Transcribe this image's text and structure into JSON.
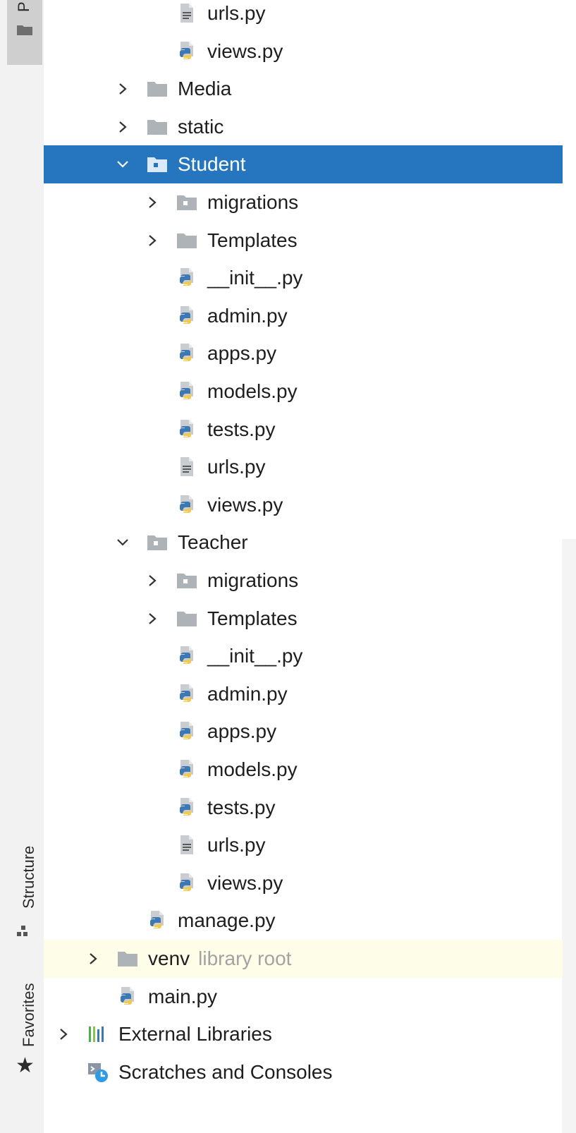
{
  "tool_windows": {
    "project_tab_letter": "P",
    "structure_label": "Structure",
    "favorites_label": "Favorites"
  },
  "colors": {
    "selection": "#2675bf",
    "excluded_background": "#fdfde8",
    "python_blue": "#3b78b4",
    "python_yellow": "#f2c94c"
  },
  "tree": [
    {
      "label": "urls.py",
      "icon": "text-file-icon",
      "level": 4,
      "chevron": "none"
    },
    {
      "label": "views.py",
      "icon": "python-file-icon",
      "level": 4,
      "chevron": "none"
    },
    {
      "label": "Media",
      "icon": "folder-icon",
      "level": 3,
      "chevron": "collapsed"
    },
    {
      "label": "static",
      "icon": "folder-icon",
      "level": 3,
      "chevron": "collapsed"
    },
    {
      "label": "Student",
      "icon": "package-folder-icon",
      "level": 3,
      "chevron": "expanded",
      "selected": true
    },
    {
      "label": "migrations",
      "icon": "package-folder-icon",
      "level": 4,
      "chevron": "collapsed"
    },
    {
      "label": "Templates",
      "icon": "folder-icon",
      "level": 4,
      "chevron": "collapsed"
    },
    {
      "label": "__init__.py",
      "icon": "python-file-icon",
      "level": 4,
      "chevron": "none"
    },
    {
      "label": "admin.py",
      "icon": "python-file-icon",
      "level": 4,
      "chevron": "none"
    },
    {
      "label": "apps.py",
      "icon": "python-file-icon",
      "level": 4,
      "chevron": "none"
    },
    {
      "label": "models.py",
      "icon": "python-file-icon",
      "level": 4,
      "chevron": "none"
    },
    {
      "label": "tests.py",
      "icon": "python-file-icon",
      "level": 4,
      "chevron": "none"
    },
    {
      "label": "urls.py",
      "icon": "text-file-icon",
      "level": 4,
      "chevron": "none"
    },
    {
      "label": "views.py",
      "icon": "python-file-icon",
      "level": 4,
      "chevron": "none"
    },
    {
      "label": "Teacher",
      "icon": "package-folder-icon",
      "level": 3,
      "chevron": "expanded"
    },
    {
      "label": "migrations",
      "icon": "package-folder-icon",
      "level": 4,
      "chevron": "collapsed"
    },
    {
      "label": "Templates",
      "icon": "folder-icon",
      "level": 4,
      "chevron": "collapsed"
    },
    {
      "label": "__init__.py",
      "icon": "python-file-icon",
      "level": 4,
      "chevron": "none"
    },
    {
      "label": "admin.py",
      "icon": "python-file-icon",
      "level": 4,
      "chevron": "none"
    },
    {
      "label": "apps.py",
      "icon": "python-file-icon",
      "level": 4,
      "chevron": "none"
    },
    {
      "label": "models.py",
      "icon": "python-file-icon",
      "level": 4,
      "chevron": "none"
    },
    {
      "label": "tests.py",
      "icon": "python-file-icon",
      "level": 4,
      "chevron": "none"
    },
    {
      "label": "urls.py",
      "icon": "text-file-icon",
      "level": 4,
      "chevron": "none"
    },
    {
      "label": "views.py",
      "icon": "python-file-icon",
      "level": 4,
      "chevron": "none"
    },
    {
      "label": "manage.py",
      "icon": "python-file-icon",
      "level": 3,
      "chevron": "none"
    },
    {
      "label": "venv",
      "hint": "library root",
      "icon": "folder-icon",
      "level": 2,
      "chevron": "collapsed",
      "excluded": true
    },
    {
      "label": "main.py",
      "icon": "python-file-icon",
      "level": 2,
      "chevron": "none"
    },
    {
      "label": "External Libraries",
      "icon": "library-icon",
      "level": 1,
      "chevron": "collapsed"
    },
    {
      "label": "Scratches and Consoles",
      "icon": "scratches-icon",
      "level": 1,
      "chevron": "none"
    }
  ]
}
